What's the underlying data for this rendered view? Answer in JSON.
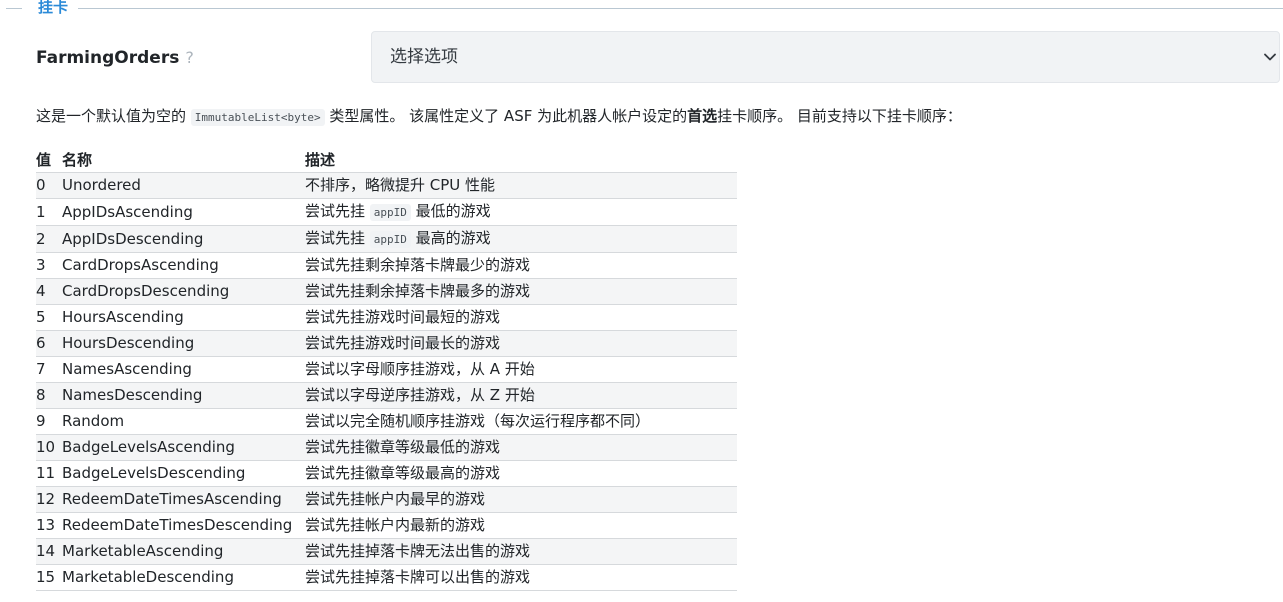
{
  "section": {
    "title": "挂卡"
  },
  "field": {
    "label": "FarmingOrders",
    "help": "?",
    "select_value": "选择选项"
  },
  "description": {
    "part1": "这是一个默认值为空的 ",
    "code": "ImmutableList<byte>",
    "part2": " 类型属性。 该属性定义了 ASF 为此机器人帐户设定的",
    "bold": "首选",
    "part3": "挂卡顺序。 目前支持以下挂卡顺序："
  },
  "table": {
    "headers": {
      "value": "值",
      "name": "名称",
      "description": "描述"
    },
    "rows": [
      {
        "value": "0",
        "name": "Unordered",
        "desc_pre": "不排序，略微提升 CPU 性能",
        "code": "",
        "desc_post": ""
      },
      {
        "value": "1",
        "name": "AppIDsAscending",
        "desc_pre": "尝试先挂 ",
        "code": "appID",
        "desc_post": " 最低的游戏"
      },
      {
        "value": "2",
        "name": "AppIDsDescending",
        "desc_pre": "尝试先挂 ",
        "code": "appID",
        "desc_post": " 最高的游戏"
      },
      {
        "value": "3",
        "name": "CardDropsAscending",
        "desc_pre": "尝试先挂剩余掉落卡牌最少的游戏",
        "code": "",
        "desc_post": ""
      },
      {
        "value": "4",
        "name": "CardDropsDescending",
        "desc_pre": "尝试先挂剩余掉落卡牌最多的游戏",
        "code": "",
        "desc_post": ""
      },
      {
        "value": "5",
        "name": "HoursAscending",
        "desc_pre": "尝试先挂游戏时间最短的游戏",
        "code": "",
        "desc_post": ""
      },
      {
        "value": "6",
        "name": "HoursDescending",
        "desc_pre": "尝试先挂游戏时间最长的游戏",
        "code": "",
        "desc_post": ""
      },
      {
        "value": "7",
        "name": "NamesAscending",
        "desc_pre": "尝试以字母顺序挂游戏，从 A 开始",
        "code": "",
        "desc_post": ""
      },
      {
        "value": "8",
        "name": "NamesDescending",
        "desc_pre": "尝试以字母逆序挂游戏，从 Z 开始",
        "code": "",
        "desc_post": ""
      },
      {
        "value": "9",
        "name": "Random",
        "desc_pre": "尝试以完全随机顺序挂游戏（每次运行程序都不同）",
        "code": "",
        "desc_post": ""
      },
      {
        "value": "10",
        "name": "BadgeLevelsAscending",
        "desc_pre": "尝试先挂徽章等级最低的游戏",
        "code": "",
        "desc_post": ""
      },
      {
        "value": "11",
        "name": "BadgeLevelsDescending",
        "desc_pre": "尝试先挂徽章等级最高的游戏",
        "code": "",
        "desc_post": ""
      },
      {
        "value": "12",
        "name": "RedeemDateTimesAscending",
        "desc_pre": "尝试先挂帐户内最早的游戏",
        "code": "",
        "desc_post": ""
      },
      {
        "value": "13",
        "name": "RedeemDateTimesDescending",
        "desc_pre": "尝试先挂帐户内最新的游戏",
        "code": "",
        "desc_post": ""
      },
      {
        "value": "14",
        "name": "MarketableAscending",
        "desc_pre": "尝试先挂掉落卡牌无法出售的游戏",
        "code": "",
        "desc_post": ""
      },
      {
        "value": "15",
        "name": "MarketableDescending",
        "desc_pre": "尝试先挂掉落卡牌可以出售的游戏",
        "code": "",
        "desc_post": ""
      }
    ]
  },
  "colors": {
    "accent": "#2b8ad8",
    "select_bg": "#f1f3f5",
    "stripe_bg": "#f4f5f6",
    "divider": "#d6d9dc"
  },
  "icons": {
    "select_arrow": "chevron-down-icon",
    "help": "question-icon"
  }
}
